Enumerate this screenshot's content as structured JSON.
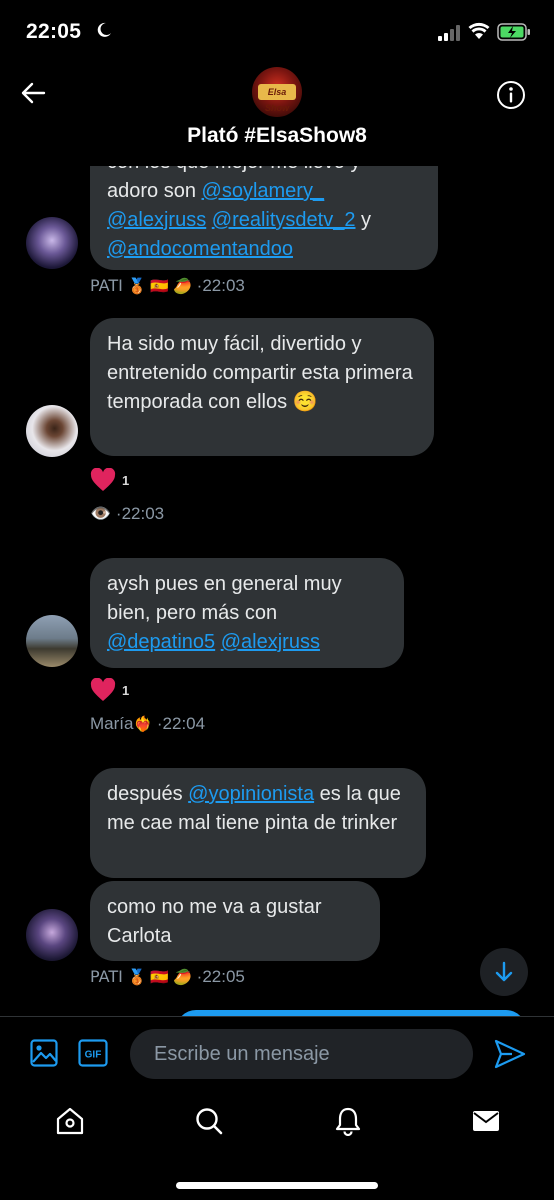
{
  "status_bar": {
    "time": "22:05"
  },
  "header": {
    "title": "Plató #ElsaShow8",
    "group_logo_text": "Elsa Show"
  },
  "messages": [
    {
      "lines_top": "con los que mejor me llevo y",
      "text_plain": "adoro son ",
      "mention1": "@soylamery_",
      "mention2": "@alexjruss",
      "mention3": "@realitysdetv_2",
      "text_y": " y",
      "mention4": "@andocomentandoo",
      "sender": "PATI",
      "time": "·22:03"
    },
    {
      "text": "Ha sido muy fácil, divertido y entretenido compartir esta primera temporada con ellos ☺️",
      "reaction_count": "1",
      "time": "·22:03"
    },
    {
      "text_plain": "aysh pues en general muy bien, pero más con ",
      "mention1": "@depatino5",
      "mention2": "@alexjruss",
      "reaction_count": "1",
      "sender": "María",
      "time": "·22:04"
    },
    {
      "text_plain1": "después ",
      "mention1": "@yopinionista",
      "text_plain2": " es la que me cae mal tiene pinta de trinker"
    },
    {
      "text": "como no me va a gustar Carlota",
      "sender": "PATI",
      "time": "·22:05"
    }
  ],
  "composer": {
    "placeholder": "Escribe un mensaje"
  },
  "nav": {
    "items": [
      "home-icon",
      "search-icon",
      "notifications-icon",
      "messages-icon"
    ]
  },
  "colors": {
    "accent": "#1d9bf0",
    "bubble": "#2f3336",
    "background": "#000000"
  }
}
